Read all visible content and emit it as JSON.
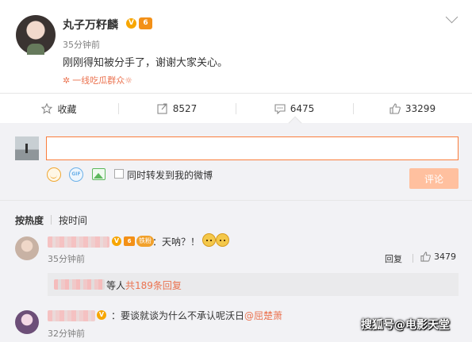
{
  "post": {
    "author": "丸子万籽麟",
    "verified_badge": "V",
    "vip_badge": "6",
    "time": "35分钟前",
    "text": "刚刚得知被分手了，谢谢大家关心。",
    "topic": "一线吃瓜群众",
    "topic_icon": "✲",
    "topic_trailing": "☼"
  },
  "actions": {
    "favorite": "收藏",
    "repost_count": "8527",
    "comment_count": "6475",
    "like_count": "33299"
  },
  "composer": {
    "input_value": "",
    "also_repost_label": "同时转发到我的微博",
    "submit_label": "评论",
    "gif_label": "GIF"
  },
  "sort": {
    "by_hot": "按热度",
    "by_time": "按时间"
  },
  "comments": [
    {
      "name_blurred": true,
      "fan_badge": "铁粉",
      "text": "：天呐？！",
      "time": "35分钟前",
      "reply_label": "回复",
      "likes": "3479",
      "sub_reply_prefix": "等人",
      "sub_reply_count": "共189条回复"
    },
    {
      "name_blurred": true,
      "text": "：要谈就谈为什么不承认呢沃日",
      "mention": "@屈楚萧",
      "time": "32分钟前"
    }
  ],
  "watermark": "搜狐号@电影天堂",
  "colors": {
    "accent": "#eb7350",
    "input_border": "#fa7d3c",
    "submit_disabled": "#ffc09f",
    "gray_bg": "#f2f2f5"
  }
}
